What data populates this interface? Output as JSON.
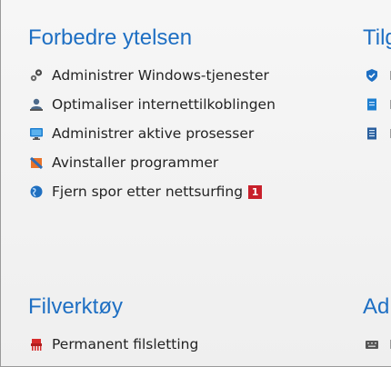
{
  "sections": {
    "performance": {
      "title": "Forbedre ytelsen",
      "items": [
        {
          "label": "Administrer Windows-tjenester",
          "icon": "gears-icon"
        },
        {
          "label": "Optimaliser internettilkoblingen",
          "icon": "network-user-icon"
        },
        {
          "label": "Administrer aktive prosesser",
          "icon": "monitor-icon"
        },
        {
          "label": "Avinstaller programmer",
          "icon": "uninstall-icon"
        },
        {
          "label": "Fjern spor etter nettsurfing",
          "icon": "globe-icon",
          "badge": "1"
        }
      ]
    },
    "file_tools": {
      "title": "Filverktøy",
      "items": [
        {
          "label": "Permanent filsletting",
          "icon": "shredder-icon"
        }
      ]
    },
    "right_top": {
      "title": "Tilg"
    },
    "right_bottom": {
      "title": "Ad"
    }
  },
  "colors": {
    "title": "#1e6fc3",
    "badge": "#c8202b"
  }
}
